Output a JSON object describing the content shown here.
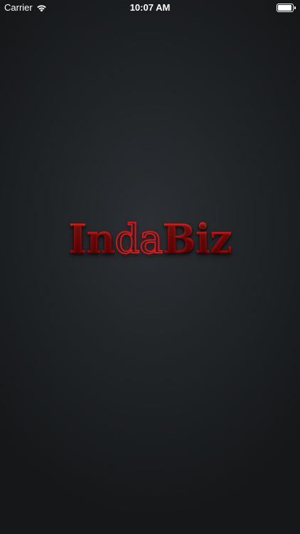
{
  "status_bar": {
    "carrier": "Carrier",
    "time": "10:07 AM",
    "wifi_icon": "wifi-icon",
    "battery_icon": "battery-icon",
    "battery_level": 1.0
  },
  "logo": {
    "part_1": "In",
    "part_2": "da",
    "part_3": "Biz",
    "primary_color": "#e01010",
    "outline_color": "#e01414"
  },
  "colors": {
    "background": "#1f2225",
    "status_text": "#ffffff"
  }
}
